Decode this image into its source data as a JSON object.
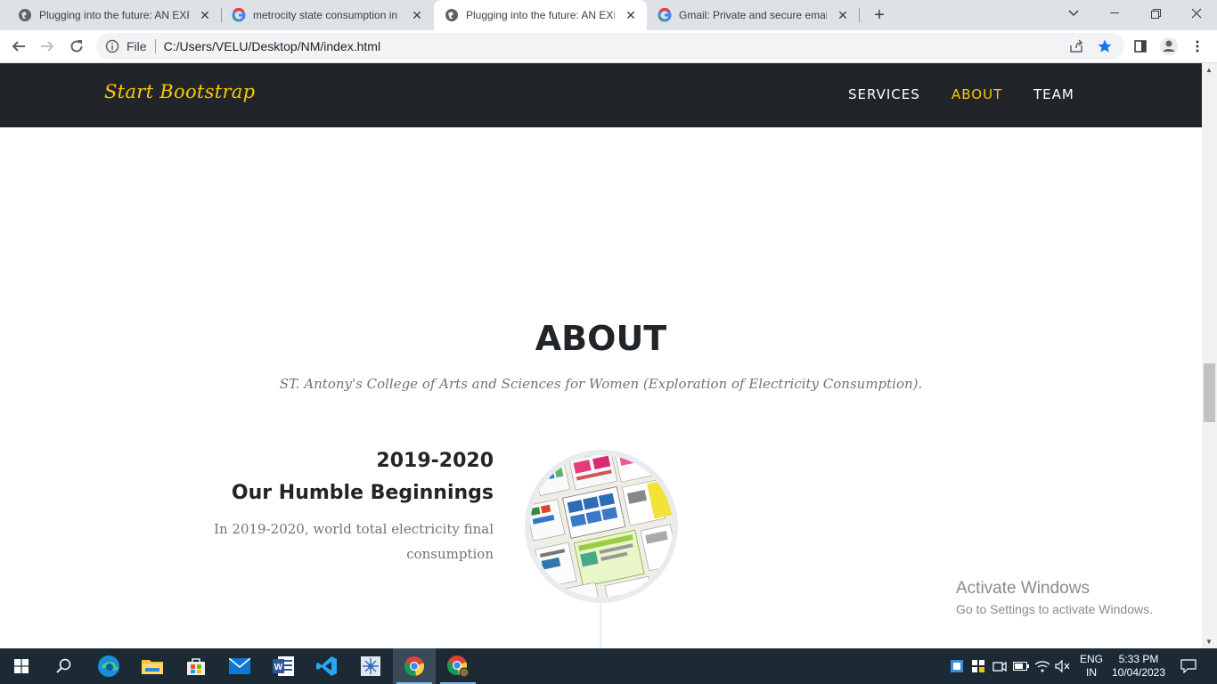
{
  "browser": {
    "tabs": [
      {
        "title": "Plugging into the future: AN EXP",
        "active": false,
        "favicon": "globe-icon"
      },
      {
        "title": "metrocity state consumption in in",
        "active": false,
        "favicon": "google-icon"
      },
      {
        "title": "Plugging into the future: AN EXP",
        "active": true,
        "favicon": "globe-icon"
      },
      {
        "title": "Gmail: Private and secure email a",
        "active": false,
        "favicon": "google-icon"
      }
    ],
    "address": {
      "scheme_label": "File",
      "url": "C:/Users/VELU/Desktop/NM/index.html"
    }
  },
  "site": {
    "brand": "Start Bootstrap",
    "nav": [
      {
        "label": "SERVICES",
        "active": false
      },
      {
        "label": "ABOUT",
        "active": true
      },
      {
        "label": "TEAM",
        "active": false
      }
    ],
    "about": {
      "heading": "ABOUT",
      "subheading": "ST. Antony's College of Arts and Sciences for Women (Exploration of Electricity Consumption).",
      "timeline": [
        {
          "year": "2019-2020",
          "title": "Our Humble Beginnings",
          "body": "In 2019-2020, world total electricity final consumption"
        }
      ]
    },
    "accent_color": "#ffc800",
    "navbar_color": "#212529"
  },
  "watermark": {
    "line1": "Activate Windows",
    "line2": "Go to Settings to activate Windows."
  },
  "taskbar": {
    "apps": [
      "windows-start-icon",
      "search-icon",
      "edge-icon",
      "file-explorer-icon",
      "store-icon",
      "mail-icon",
      "word-icon",
      "vscode-icon",
      "snipping-icon",
      "chrome-icon",
      "chrome-profile-icon"
    ],
    "language": "ENG",
    "region": "IN",
    "time": "5:33 PM",
    "date": "10/04/2023"
  }
}
